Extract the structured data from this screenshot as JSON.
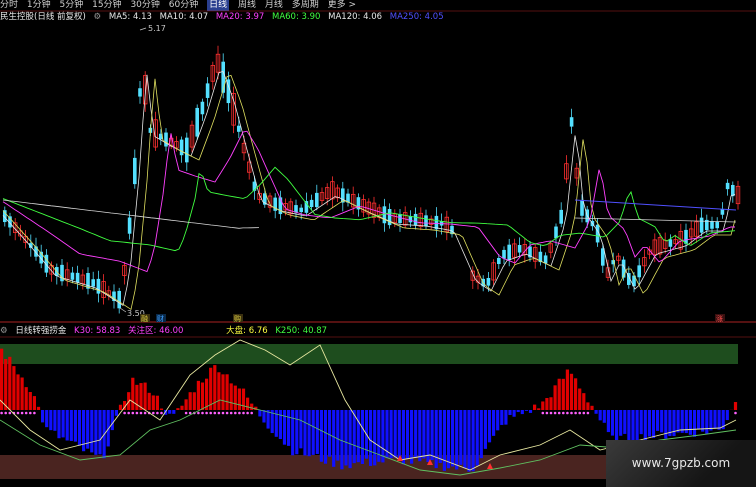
{
  "toolbar": {
    "periods": [
      "分时",
      "1分钟",
      "5分钟",
      "15分钟",
      "30分钟",
      "60分钟",
      "日线",
      "周线",
      "月线",
      "多周期",
      "更多 >"
    ],
    "active": "日线"
  },
  "main_panel": {
    "title": "民生控股(日线 前复权)",
    "ma": [
      {
        "label": "MA5: 4.13",
        "color": "#e8e8e8"
      },
      {
        "label": "MA10: 4.07",
        "color": "#e8e8e8"
      },
      {
        "label": "MA20: 3.97",
        "color": "#ff40ff"
      },
      {
        "label": "MA60: 3.90",
        "color": "#40ff40"
      },
      {
        "label": "MA120: 4.06",
        "color": "#e8e8e8"
      },
      {
        "label": "MA250: 4.05",
        "color": "#5050ff"
      }
    ],
    "high_label": "5.17",
    "low_label": "3.50",
    "markers": [
      {
        "text": "融",
        "color": "#e0d040"
      },
      {
        "text": "财",
        "color": "#40a0ff"
      },
      {
        "text": "购",
        "color": "#e0d040"
      },
      {
        "text": "涨",
        "color": "#ff5050"
      }
    ]
  },
  "sub_panel": {
    "title": "日线转强捞金",
    "items": [
      {
        "label": "K30: 58.83",
        "color": "#ff40ff"
      },
      {
        "label": "关注区: 46.00",
        "color": "#ff40ff"
      },
      {
        "label": "大盘: 6.76",
        "color": "#ffff40"
      },
      {
        "label": "K250: 40.87",
        "color": "#40ff40"
      }
    ]
  },
  "watermark": "www.7gpzb.com",
  "colors": {
    "up": "#ff3030",
    "down": "#54e0ff",
    "bar_red": "#e00000",
    "bar_blue": "#1010ff",
    "band_green": "#1e4d1e",
    "band_brown": "#4a2420"
  }
}
